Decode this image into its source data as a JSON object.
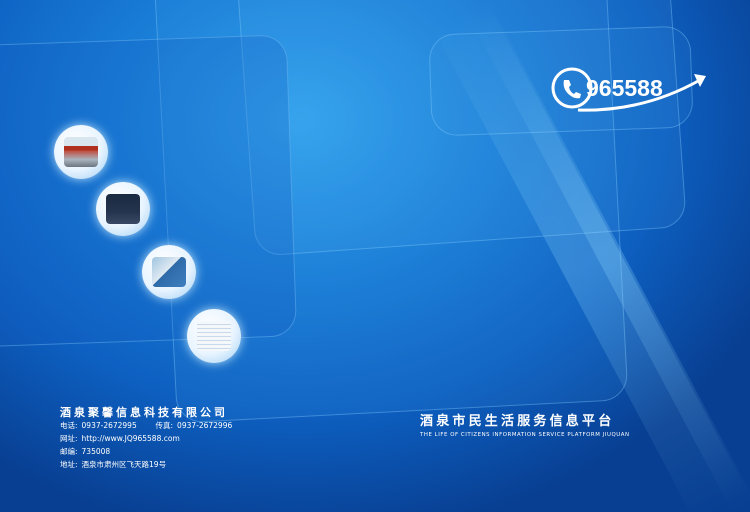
{
  "logo": {
    "number": "965588",
    "colors": {
      "primary": "#ffffff",
      "icon": "phone-icon"
    }
  },
  "company": {
    "name": "酒泉聚馨信息科技有限公司",
    "phone_label": "电话:",
    "phone": "0937-2672995",
    "fax_label": "传真:",
    "fax": "0937-2672996",
    "website_label": "网址:",
    "website": "http://www.JQ965588.com",
    "postcode_label": "邮编:",
    "postcode": "735008",
    "address_label": "地址:",
    "address": "酒泉市肃州区飞天路19号"
  },
  "platform": {
    "title": "酒泉市民生活服务信息平台",
    "subtitle": "THE LIFE OF CITIZENS INFORMATION SERVICE PLATFORM JIUQUAN"
  },
  "photos": [
    {
      "name": "building-photo"
    },
    {
      "name": "dark-screen-photo"
    },
    {
      "name": "service-desk-photo"
    },
    {
      "name": "spreadsheet-photo"
    }
  ]
}
